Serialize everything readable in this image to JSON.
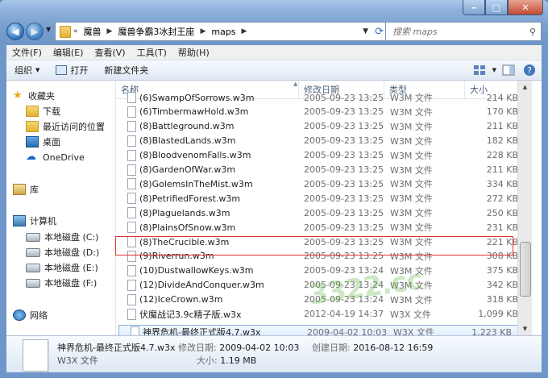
{
  "address": {
    "segments": [
      "魔兽",
      "魔兽争霸3冰封王座",
      "maps"
    ]
  },
  "search": {
    "placeholder": "搜索 maps"
  },
  "menu": [
    "文件(F)",
    "编辑(E)",
    "查看(V)",
    "工具(T)",
    "帮助(H)"
  ],
  "toolbar": {
    "organize": "组织",
    "open": "打开",
    "new_folder": "新建文件夹"
  },
  "nav_pane": {
    "favorites": "收藏夹",
    "fav_items": [
      "下载",
      "最近访问的位置",
      "桌面",
      "OneDrive"
    ],
    "library": "库",
    "computer": "计算机",
    "drives": [
      "本地磁盘 (C:)",
      "本地磁盘 (D:)",
      "本地磁盘 (E:)",
      "本地磁盘 (F:)"
    ],
    "network": "网络"
  },
  "columns": {
    "name": "名称",
    "date": "修改日期",
    "type": "类型",
    "size": "大小"
  },
  "files": [
    {
      "name": "(6)SwampOfSorrows.w3m",
      "date": "2005-09-23 13:25",
      "type": "W3M 文件",
      "size": "214 KB"
    },
    {
      "name": "(6)TimbermawHold.w3m",
      "date": "2005-09-23 13:25",
      "type": "W3M 文件",
      "size": "170 KB"
    },
    {
      "name": "(8)Battleground.w3m",
      "date": "2005-09-23 13:25",
      "type": "W3M 文件",
      "size": "211 KB"
    },
    {
      "name": "(8)BlastedLands.w3m",
      "date": "2005-09-23 13:25",
      "type": "W3M 文件",
      "size": "182 KB"
    },
    {
      "name": "(8)BloodvenomFalls.w3m",
      "date": "2005-09-23 13:25",
      "type": "W3M 文件",
      "size": "228 KB"
    },
    {
      "name": "(8)GardenOfWar.w3m",
      "date": "2005-09-23 13:25",
      "type": "W3M 文件",
      "size": "211 KB"
    },
    {
      "name": "(8)GolemsInTheMist.w3m",
      "date": "2005-09-23 13:25",
      "type": "W3M 文件",
      "size": "334 KB"
    },
    {
      "name": "(8)PetrifiedForest.w3m",
      "date": "2005-09-23 13:25",
      "type": "W3M 文件",
      "size": "272 KB"
    },
    {
      "name": "(8)Plaguelands.w3m",
      "date": "2005-09-23 13:25",
      "type": "W3M 文件",
      "size": "250 KB"
    },
    {
      "name": "(8)PlainsOfSnow.w3m",
      "date": "2005-09-23 13:25",
      "type": "W3M 文件",
      "size": "231 KB"
    },
    {
      "name": "(8)TheCrucible.w3m",
      "date": "2005-09-23 13:25",
      "type": "W3M 文件",
      "size": "221 KB"
    },
    {
      "name": "(9)Riverrun.w3m",
      "date": "2005-09-23 13:25",
      "type": "W3M 文件",
      "size": "308 KB"
    },
    {
      "name": "(10)DustwallowKeys.w3m",
      "date": "2005-09-23 13:24",
      "type": "W3M 文件",
      "size": "375 KB"
    },
    {
      "name": "(12)DivideAndConquer.w3m",
      "date": "2005-09-23 13:24",
      "type": "W3M 文件",
      "size": "342 KB"
    },
    {
      "name": "(12)IceCrown.w3m",
      "date": "2005-09-23 13:24",
      "type": "W3M 文件",
      "size": "318 KB"
    },
    {
      "name": "伏魔战记3.9c精子版.w3x",
      "date": "2012-04-19 14:37",
      "type": "W3X 文件",
      "size": "1,099 KB"
    },
    {
      "name": "神界危机-最终正式版4.7.w3x",
      "date": "2009-04-02 10:03",
      "type": "W3X 文件",
      "size": "1,223 KB"
    }
  ],
  "watermark": "3322.cc",
  "details": {
    "name": "神界危机-最终正式版4.7.w3x",
    "type": "W3X 文件",
    "modified_label": "修改日期:",
    "modified": "2009-04-02 10:03",
    "size_label": "大小:",
    "size": "1.19 MB",
    "created_label": "创建日期:",
    "created": "2016-08-12 16:59"
  }
}
